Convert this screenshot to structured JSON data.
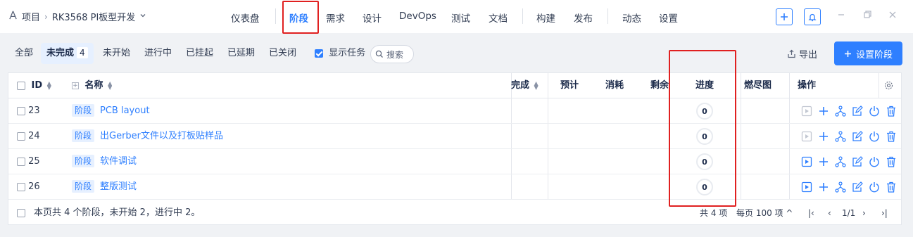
{
  "breadcrumb": {
    "root": "项目",
    "project": "RK3568 PI板型开发"
  },
  "nav": {
    "tabs": [
      "仪表盘",
      "阶段",
      "需求",
      "设计",
      "DevOps",
      "测试",
      "文档",
      "构建",
      "发布",
      "动态",
      "设置"
    ],
    "active": "阶段"
  },
  "filters": {
    "tabs": [
      "全部",
      "未完成",
      "未开始",
      "进行中",
      "已挂起",
      "已延期",
      "已关闭"
    ],
    "active_count": "4",
    "show_tasks": "显示任务",
    "search_placeholder": "搜索"
  },
  "toolbar": {
    "export": "导出",
    "primary": "设置阶段"
  },
  "table": {
    "columns": {
      "id": "ID",
      "name": "名称",
      "done": "完成",
      "estimate": "预计",
      "consumed": "消耗",
      "left": "剩余",
      "progress": "进度",
      "burndown": "燃尽图",
      "actions": "操作"
    },
    "rows": [
      {
        "id": "23",
        "tag": "阶段",
        "name": "PCB layout",
        "progress": "0",
        "start_enabled": false
      },
      {
        "id": "24",
        "tag": "阶段",
        "name": "出Gerber文件以及打板贴样品",
        "progress": "0",
        "start_enabled": false
      },
      {
        "id": "25",
        "tag": "阶段",
        "name": "软件调试",
        "progress": "0",
        "start_enabled": true
      },
      {
        "id": "26",
        "tag": "阶段",
        "name": "整版测试",
        "progress": "0",
        "start_enabled": true
      }
    ]
  },
  "footer": {
    "summary": "本页共 4 个阶段，未开始 2，进行中 2。",
    "total": "共 4 项",
    "per_page": "每页 100 项",
    "page": "1/1"
  },
  "colors": {
    "accent": "#2e7fff",
    "highlight": "#e02020"
  }
}
